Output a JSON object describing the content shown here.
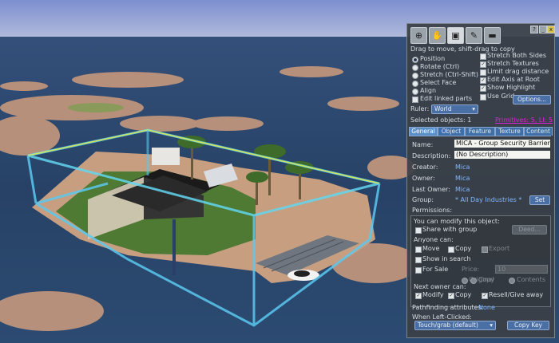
{
  "toolbar": {
    "icons": [
      "zoom-icon",
      "grab-hand-icon",
      "edit-cube-icon",
      "create-wand-icon",
      "land-bulldozer-icon"
    ],
    "window_buttons": [
      "?",
      "_",
      "x"
    ]
  },
  "hint": "Drag to move, shift-drag to copy",
  "modes": [
    {
      "label": "Position",
      "selected": true
    },
    {
      "label": "Rotate (Ctrl)",
      "selected": false
    },
    {
      "label": "Stretch (Ctrl-Shift)",
      "selected": false
    },
    {
      "label": "Select Face",
      "selected": false
    },
    {
      "label": "Align",
      "selected": false
    }
  ],
  "edit_linked": {
    "label": "Edit linked parts",
    "checked": false
  },
  "options_right": [
    {
      "label": "Stretch Both Sides",
      "checked": false
    },
    {
      "label": "Stretch Textures",
      "checked": true
    },
    {
      "label": "Limit drag distance",
      "checked": false
    },
    {
      "label": "Edit Axis at Root",
      "checked": true
    },
    {
      "label": "Show Highlight",
      "checked": true
    },
    {
      "label": "Use Grid",
      "checked": false
    }
  ],
  "options_button": "Options...",
  "ruler": {
    "label": "Ruler:",
    "value": "World"
  },
  "selected_objects": "Selected objects: 1",
  "primitives": "Primitives: 5, LI: 5",
  "tabs": [
    {
      "label": "General",
      "selected": true
    },
    {
      "label": "Object",
      "selected": false
    },
    {
      "label": "Feature",
      "selected": false
    },
    {
      "label": "Texture",
      "selected": false
    },
    {
      "label": "Content",
      "selected": false
    }
  ],
  "general": {
    "name_label": "Name:",
    "name_value": "MICA - Group Security Barrier",
    "desc_label": "Description:",
    "desc_value": "(No Description)",
    "creator_label": "Creator:",
    "creator_value": "Mica",
    "owner_label": "Owner:",
    "owner_value": "Mica",
    "last_owner_label": "Last Owner:",
    "last_owner_value": "Mica",
    "group_label": "Group:",
    "group_value": "* All Day Industries *",
    "group_set": "Set",
    "permissions_label": "Permissions:",
    "can_modify": "You can modify this object:",
    "share_label": "Share with group",
    "share_checked": false,
    "deed_button": "Deed...",
    "anyone_can": "Anyone can:",
    "anyone_move": "Move",
    "anyone_copy": "Copy",
    "anyone_export": "Export",
    "show_in_search": "Show in search",
    "for_sale": "For Sale",
    "price_label": "Price:",
    "price_value": "10",
    "sale_original": "Original",
    "sale_copy": "Copy",
    "sale_contents": "Contents",
    "next_owner": "Next owner can:",
    "next_modify": "Modify",
    "next_copy": "Copy",
    "next_resell": "Resell/Give away",
    "pathfinding_label": "Pathfinding attributes:",
    "pathfinding_value": "None",
    "when_clicked": "When Left-Clicked:",
    "click_action": "Touch/grab (default)",
    "copy_key": "Copy Key"
  },
  "colors": {
    "panel_bg": "#3a4046",
    "accent": "#4a6fa5",
    "primitives": "#e020e0",
    "link": "#7fb8ff"
  }
}
